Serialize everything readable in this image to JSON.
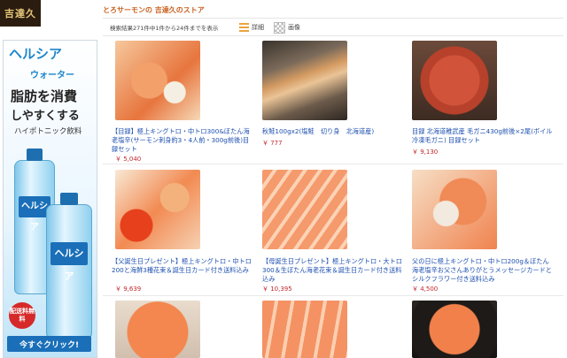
{
  "logo_text": "吉達久",
  "store_title": "とろサーモンの 吉達久のストア",
  "result_text": "検索結果271件中1件から24件までを表示",
  "views": {
    "detail": "詳細",
    "image": "画像"
  },
  "ad": {
    "brand": "ヘルシア",
    "sub": "ウォーター",
    "line1": "脂肪を消費",
    "line2": "しやすくする",
    "line3": "ハイポトニック飲料",
    "bottle_label": "ヘルシア",
    "badge": "配送料無料",
    "cta": "今すぐクリック!"
  },
  "products": [
    {
      "name": "【目録】極上キングトロ・中トロ300&ぼたん海老塩辛(サーモン刺身約3・4人前・300g前後)目録セット",
      "price": "￥ 5,040"
    },
    {
      "name": "秋鮭100gx2(塩鮭　切り身　北海道産)",
      "price": "￥ 777"
    },
    {
      "name": "目録 北海道稚武産 毛ガニ430g前後×2尾(ボイル冷凍毛ガニ) 目録セット",
      "price": "￥ 9,130"
    },
    {
      "name": "【父誕生日プレゼント】極上キングトロ・中トロ200と海鮮3種花束＆誕生日カード付き送料込み",
      "price": "￥ 9,639"
    },
    {
      "name": "【母誕生日プレゼント】極上キングトロ・大トロ300＆生ぼたん海老花束＆誕生日カード付き送料込み",
      "price": "￥ 10,395"
    },
    {
      "name": "父の日に極上キングトロ・中トロ200g＆ぼたん海老塩辛お父さんありがとうメッセージカードとシルクフラワー付き送料込み",
      "price": "￥ 4,500"
    }
  ]
}
